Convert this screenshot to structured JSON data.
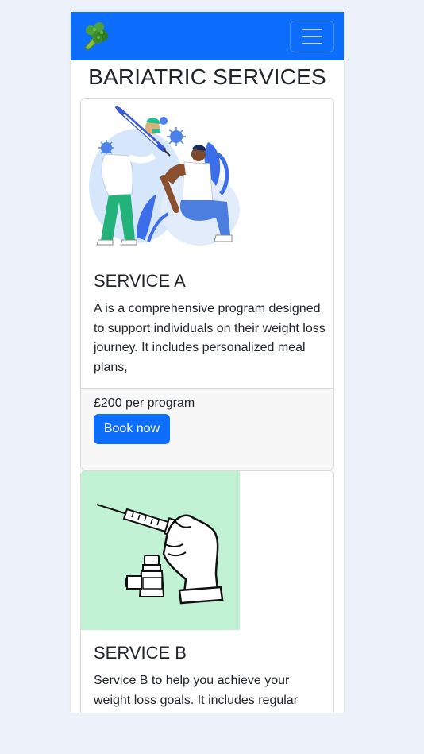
{
  "navbar": {
    "logo_icon": "broccoli-icon",
    "menu_icon": "hamburger-menu-icon",
    "background": "#0d6efd"
  },
  "page_title": "BARIATRIC SERVICES",
  "services": [
    {
      "image_icon": "vaccination-illustration",
      "title": "SERVICE A",
      "description": "A is a comprehensive program designed to support individuals on their weight loss journey. It includes personalized meal plans,",
      "price": "£200 per program",
      "button_label": "Book now"
    },
    {
      "image_icon": "syringe-vial-illustration",
      "title": "SERVICE B",
      "description": "Service B to help you achieve your weight loss goals. It includes regular"
    }
  ],
  "colors": {
    "primary": "#0d6efd",
    "page_background": "#edf1f9",
    "service_b_image_background": "#c2f2d4"
  }
}
